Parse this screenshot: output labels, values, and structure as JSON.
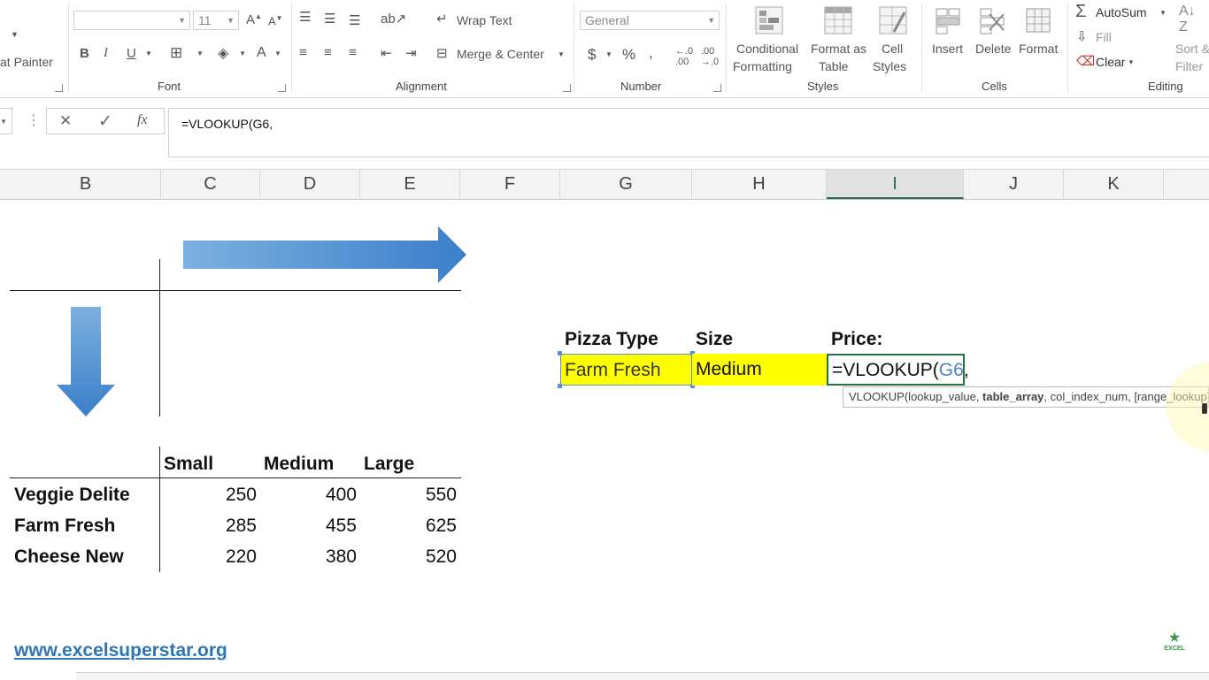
{
  "ribbon": {
    "clipboard": {
      "format_painter": "at Painter"
    },
    "font": {
      "group_label": "Font",
      "font_name": "",
      "font_size": "11",
      "bold": "B",
      "italic": "I",
      "underline": "U",
      "font_color": "A"
    },
    "alignment": {
      "group_label": "Alignment",
      "wrap_text": "Wrap Text",
      "merge_center": "Merge & Center"
    },
    "number": {
      "group_label": "Number",
      "format": "General",
      "currency": "$",
      "percent": "%",
      "comma": ","
    },
    "styles": {
      "group_label": "Styles",
      "conditional": [
        "Conditional",
        "Formatting"
      ],
      "format_table": [
        "Format as",
        "Table"
      ],
      "cell_styles": [
        "Cell",
        "Styles"
      ]
    },
    "cells": {
      "group_label": "Cells",
      "insert": "Insert",
      "delete": "Delete",
      "format": "Format"
    },
    "editing": {
      "group_label": "Editing",
      "autosum": "AutoSum",
      "fill": "Fill",
      "clear": "Clear",
      "sort": [
        "Sort &",
        "Filter"
      ]
    }
  },
  "formula_bar": {
    "cancel": "✕",
    "enter": "✓",
    "fx": "fx",
    "formula": "=VLOOKUP(G6,"
  },
  "columns": [
    "B",
    "C",
    "D",
    "E",
    "F",
    "G",
    "H",
    "I",
    "J",
    "K"
  ],
  "active_column": "I",
  "lookup_table": {
    "headers": [
      "Small",
      "Medium",
      "Large"
    ],
    "rows": [
      {
        "name": "Veggie Delite",
        "values": [
          "250",
          "400",
          "550"
        ]
      },
      {
        "name": "Farm Fresh",
        "values": [
          "285",
          "455",
          "625"
        ]
      },
      {
        "name": "Cheese New",
        "values": [
          "220",
          "380",
          "520"
        ]
      }
    ]
  },
  "lookup_inputs": {
    "pizza_type_label": "Pizza Type",
    "size_label": "Size",
    "price_label": "Price:",
    "pizza_type_value": "Farm Fresh",
    "size_value": "Medium",
    "formula_prefix": "=VLOOKUP(",
    "formula_ref": "G6",
    "formula_suffix": ","
  },
  "tooltip": {
    "fn": "VLOOKUP(lookup_value, ",
    "current_arg": "table_array",
    "rest": ", col_index_num, [range_lookup])"
  },
  "website": "www.excelsuperstar.org",
  "logo_text": "EXCEL",
  "colors": {
    "highlight": "#ffff00",
    "arrow_blue": "#4a8fd4",
    "excel_green": "#217346",
    "ref_blue": "#4f81c7"
  }
}
